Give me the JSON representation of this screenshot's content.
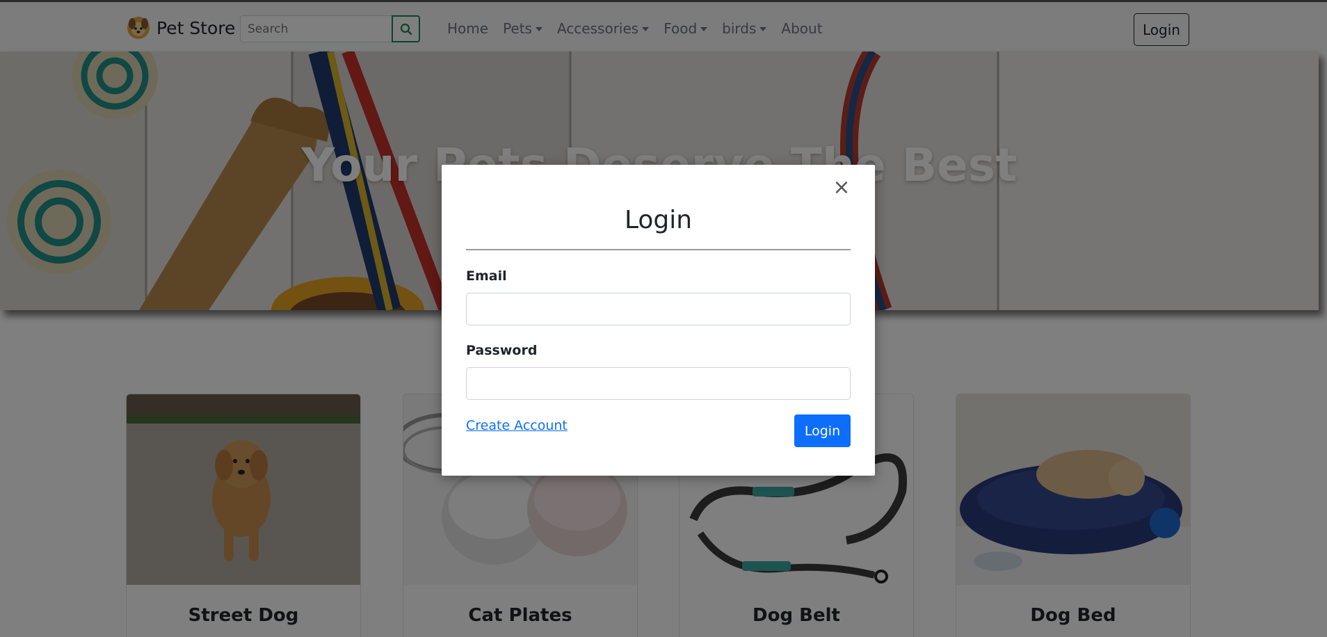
{
  "navbar": {
    "brand": "Pet Store",
    "search": {
      "placeholder": "Search",
      "value": ""
    },
    "links": [
      {
        "label": "Home",
        "dropdown": false
      },
      {
        "label": "Pets",
        "dropdown": true
      },
      {
        "label": "Accessories",
        "dropdown": true
      },
      {
        "label": "Food",
        "dropdown": true
      },
      {
        "label": "birds",
        "dropdown": true
      },
      {
        "label": "About",
        "dropdown": false
      }
    ],
    "login_label": "Login"
  },
  "hero": {
    "title": "Your Pets Deserve The Best"
  },
  "products": [
    {
      "title": "Street Dog"
    },
    {
      "title": "Cat Plates"
    },
    {
      "title": "Dog Belt"
    },
    {
      "title": "Dog Bed"
    }
  ],
  "modal": {
    "title": "Login",
    "email_label": "Email",
    "email_value": "",
    "password_label": "Password",
    "password_value": "",
    "create_account_label": "Create Account",
    "submit_label": "Login",
    "close_glyph": "×"
  },
  "colors": {
    "primary": "#0d6efd",
    "search_button_border": "#198754",
    "backdrop": "rgba(0,0,0,0.5)"
  }
}
